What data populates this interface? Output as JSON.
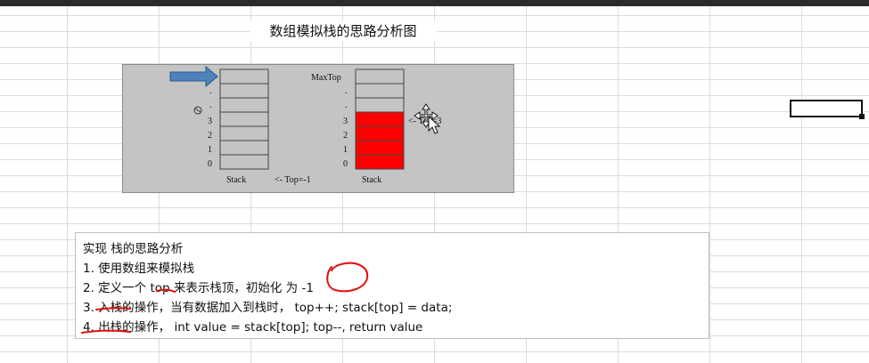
{
  "title": "数组模拟栈的思路分析图",
  "diagram": {
    "left_stack": {
      "indices": [
        "3",
        "2",
        "1",
        "0"
      ],
      "dots": [
        ".",
        "."
      ],
      "label": "Stack",
      "pointer_label": "<- Top=-1"
    },
    "right_stack": {
      "indices": [
        "3",
        "2",
        "1",
        "0"
      ],
      "dots": [
        ".",
        "."
      ],
      "label": "Stack",
      "maxtop_label": "MaxTop",
      "pointer_label": "<- Top=3",
      "fill_color": "#ff0000"
    }
  },
  "notes": {
    "heading": "实现 栈的思路分析",
    "item1": "1. 使用数组来模拟栈",
    "item2": "2. 定义一个 top  来表示栈顶，初始化 为  -1",
    "item3": "3. 入栈的操作，当有数据加入到栈时，  top++;  stack[top] = data;",
    "item4": "4. 出栈的操作，  int value = stack[top]; top--, return value"
  },
  "colors": {
    "arrow": "#4f81bd",
    "annotation": "#e01010"
  }
}
